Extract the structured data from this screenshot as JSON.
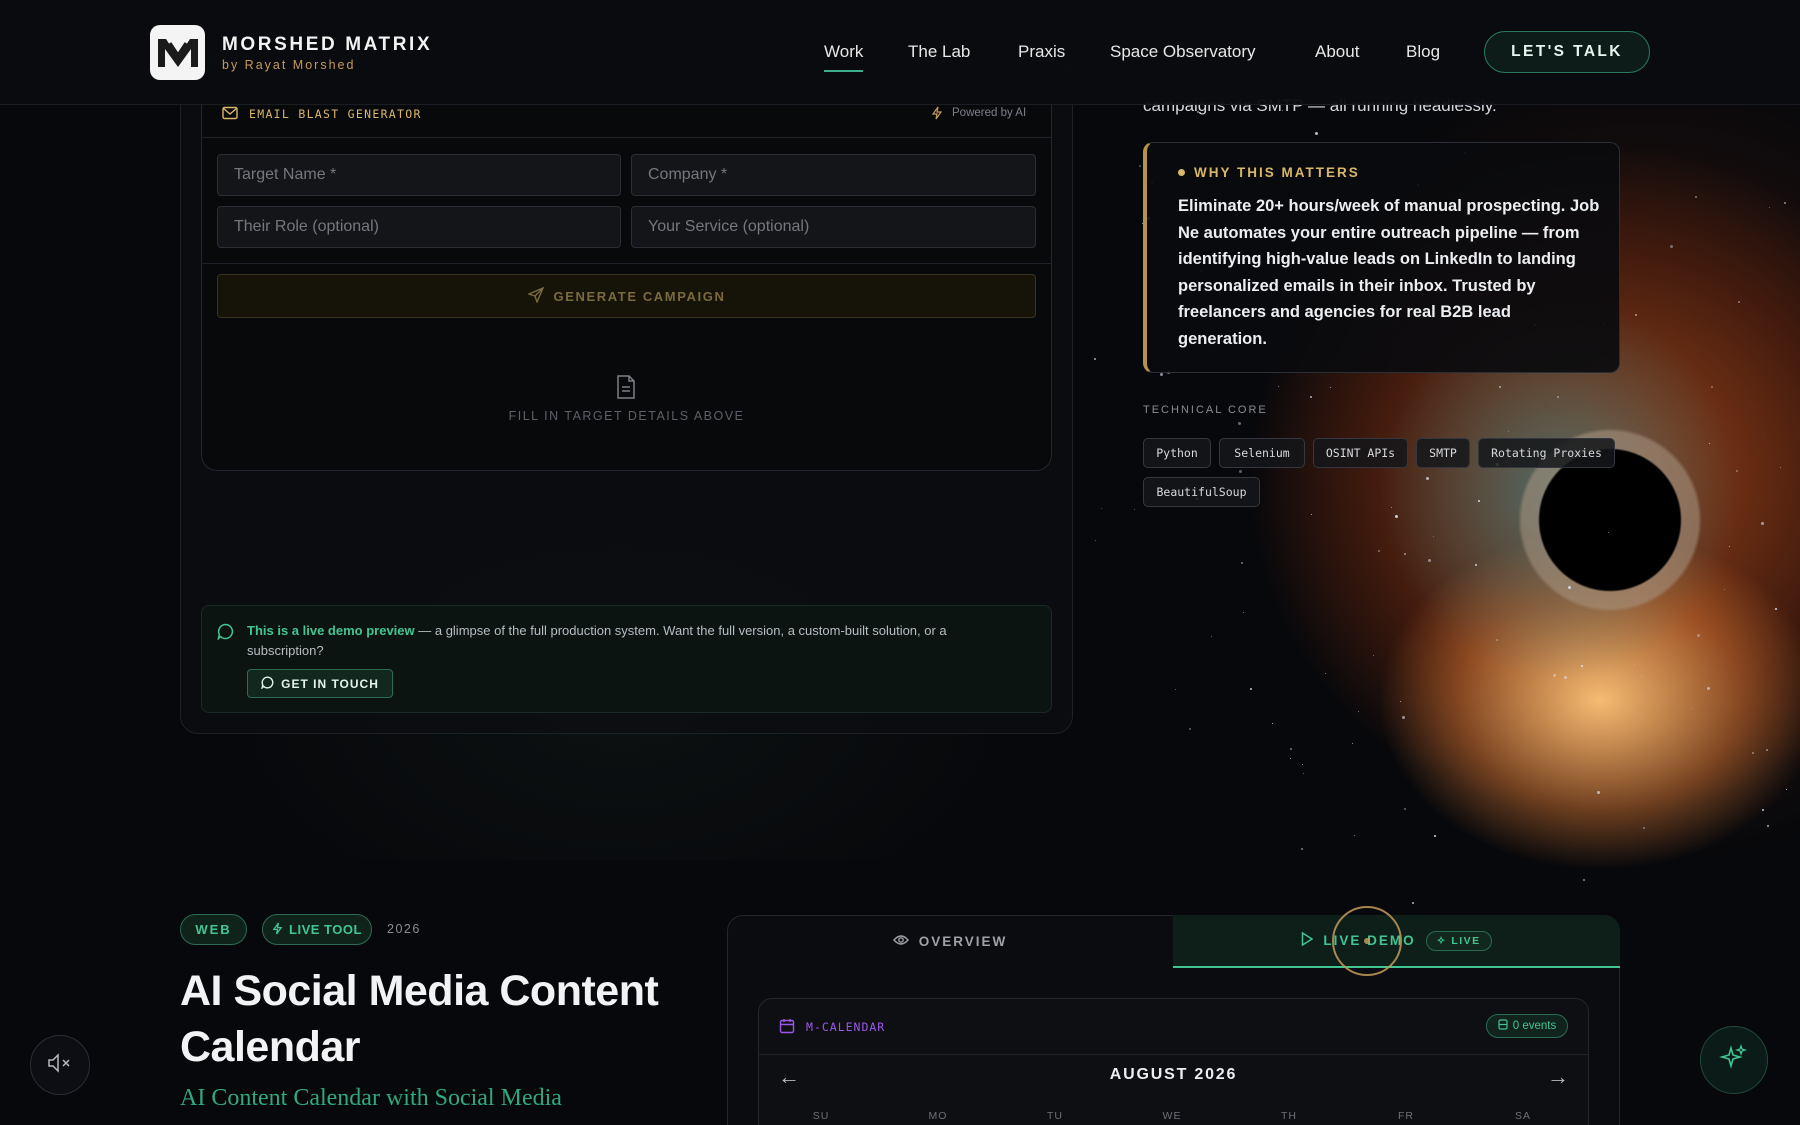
{
  "brand": {
    "title": "MORSHED MATRIX",
    "subtitle": "by Rayat Morshed",
    "logo_icon": "mm-monogram-logo"
  },
  "nav": {
    "items": [
      {
        "label": "Work",
        "active": true
      },
      {
        "label": "The Lab",
        "active": false
      },
      {
        "label": "Praxis",
        "active": false
      },
      {
        "label": "Space Observatory",
        "active": false
      },
      {
        "label": "About",
        "active": false
      },
      {
        "label": "Blog",
        "active": false
      }
    ],
    "cta": "LET'S TALK"
  },
  "email_tool": {
    "title": "EMAIL BLAST GENERATOR",
    "powered": "Powered by AI",
    "fields": {
      "target_name": "Target Name *",
      "company": "Company *",
      "role": "Their Role (optional)",
      "service": "Your Service (optional)"
    },
    "generate_label": "GENERATE CAMPAIGN",
    "empty_state": "FILL IN TARGET DETAILS ABOVE"
  },
  "demo_note": {
    "highlight": "This is a live demo preview",
    "text": " — a glimpse of the full production system. Want the full version, a custom-built solution, or a subscription?",
    "button": "GET IN TOUCH"
  },
  "project_info": {
    "snippet": "campaigns via SMTP — all running headlessly.",
    "why_title": "WHY THIS MATTERS",
    "why_body": "Eliminate 20+ hours/week of manual prospecting. Job Ne automates your entire outreach pipeline — from identifying high-value leads on LinkedIn to landing personalized emails in their inbox. Trusted by freelancers and agencies for real B2B lead generation.",
    "tech_label": "TECHNICAL CORE",
    "tech": [
      "Python",
      "Selenium",
      "OSINT APIs",
      "SMTP",
      "Rotating Proxies",
      "BeautifulSoup"
    ]
  },
  "next_project": {
    "tags": [
      "WEB",
      "LIVE TOOL"
    ],
    "year": "2026",
    "title": "AI Social Media Content Calendar",
    "subtitle": "AI Content Calendar with Social Media",
    "tabs": {
      "overview": "OVERVIEW",
      "live": "LIVE DEMO",
      "live_badge": "LIVE"
    }
  },
  "calendar": {
    "label": "M-CALENDAR",
    "events": "0 events",
    "month": "AUGUST 2026",
    "prev": "←",
    "next": "→",
    "weekdays": [
      "SU",
      "MO",
      "TU",
      "WE",
      "TH",
      "FR",
      "SA"
    ]
  },
  "colors": {
    "accent_green": "#43c592",
    "accent_gold": "#d9b76a",
    "calendar_purple": "#9b59e8"
  }
}
